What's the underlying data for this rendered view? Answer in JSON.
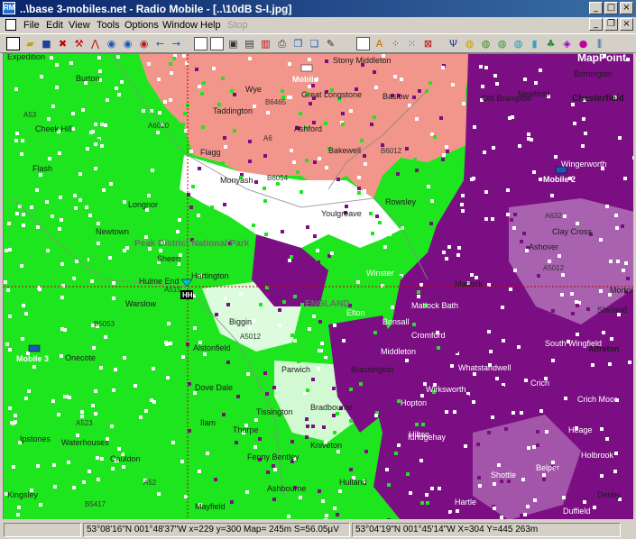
{
  "window": {
    "title": "..\\base 3-mobiles.net - Radio Mobile - [..\\10dB S-I.jpg]",
    "app_icon_text": "RM"
  },
  "menu": {
    "items": [
      "File",
      "Edit",
      "View",
      "Tools",
      "Options",
      "Window",
      "Help",
      "Stop"
    ]
  },
  "map": {
    "colors": {
      "green": "#1ee61e",
      "purple": "#7c0e84",
      "salmon": "#f2958a",
      "white": "#ffffff"
    },
    "towns": [
      "Stony Middleton",
      "Burton",
      "Baslow",
      "Brimington",
      "Chesterfield",
      "Great Longstone",
      "Taddington",
      "Old Brampton",
      "Newbold",
      "Ashford",
      "Cheek Hill",
      "Flash",
      "Flagg",
      "Bakewell",
      "Monyash",
      "Wingerworth",
      "Longnor",
      "Rowsley",
      "Youlgreave",
      "Clay Cross",
      "Newtown",
      "Ashover",
      "Hartington",
      "Winster",
      "Matlock",
      "Morton",
      "Warslow",
      "Matlock Bath",
      "Shirland",
      "Alstonfield",
      "Cromford",
      "South Wingfield",
      "Middleton",
      "Alfreton",
      "Onecote",
      "Parwich",
      "Brassington",
      "Wirksworth",
      "Crich",
      "Dove Dale",
      "Ilam",
      "Ipstones",
      "Waterhouses",
      "Thorpe",
      "Kniveton",
      "Idridgehay",
      "Cauldon",
      "Kingsley",
      "Mayfield",
      "Ashbourne",
      "Hulland",
      "Denby",
      "Expedition",
      "Wye",
      "Hilton",
      "Whatstandwell",
      "Hartle",
      "Heage",
      "Belper",
      "Holbrook",
      "Duffield",
      "Shottle",
      "Crich Moor",
      "Elton",
      "Bonsall",
      "Bradbourne",
      "Hopton",
      "Tissington",
      "Fenny Bentley",
      "Biggin",
      "Sheen",
      "Hulme End"
    ],
    "region_labels": [
      "Peak District National Park",
      "ENGLAND"
    ],
    "roads": [
      "A6020",
      "B6465",
      "A6",
      "B6012",
      "B6054",
      "A515",
      "A5012",
      "B5053",
      "A53",
      "A523",
      "B5417",
      "A52",
      "A5012",
      "A632"
    ],
    "mobiles": [
      "Mobile",
      "Mobile 2",
      "Mobile 3"
    ],
    "base_label": "HH",
    "watermark": "MapPoint"
  },
  "status": {
    "panel1": "53°08'16\"N  001°48'37\"W   x=229 y=300 Map= 245m S=56.05µV",
    "panel2": "53°04'19\"N  001°45'14\"W  X=304 Y=445 263m"
  }
}
